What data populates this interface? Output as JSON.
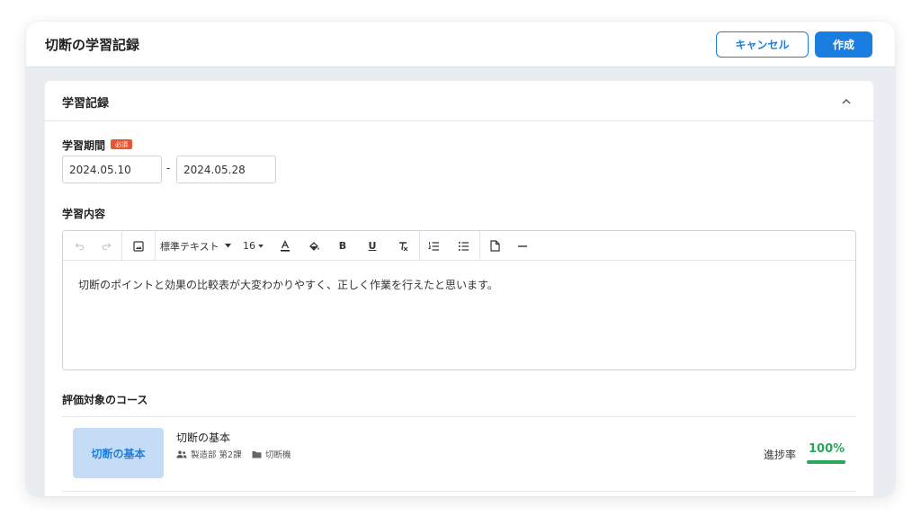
{
  "header": {
    "title": "切断の学習記録",
    "cancel_label": "キャンセル",
    "create_label": "作成"
  },
  "section": {
    "title": "学習記録"
  },
  "period": {
    "label": "学習期間",
    "required_badge": "必須",
    "start": "2024.05.10",
    "separator": "-",
    "end": "2024.05.28"
  },
  "content": {
    "label": "学習内容",
    "toolbar": {
      "text_style": "標準テキスト",
      "font_size": "16",
      "bold": "B",
      "underline": "U"
    },
    "body": "切断のポイントと効果の比較表が大変わかりやすく、正しく作業を行えたと思います。"
  },
  "course": {
    "section_label": "評価対象のコース",
    "thumbnail_label": "切断の基本",
    "name": "切断の基本",
    "department": "製造部 第2課",
    "category": "切断機",
    "progress_label": "進捗率",
    "progress_value": "100%",
    "progress_fraction": 1.0
  },
  "colors": {
    "primary": "#1a7de0",
    "required": "#e8572f",
    "progress": "#27a85a",
    "thumbnail_bg": "#c5dcf7"
  }
}
